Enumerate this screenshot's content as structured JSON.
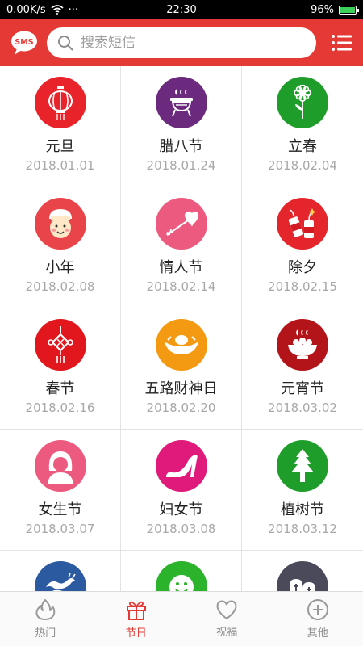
{
  "status_bar": {
    "speed": "0.00K/s",
    "dots": "···",
    "time": "22:30",
    "battery": "96%"
  },
  "header": {
    "badge_text": "SMS",
    "search_placeholder": "搜索短信"
  },
  "colors": {
    "accent": "#e53935"
  },
  "holidays": [
    {
      "name": "元旦",
      "date": "2018.01.01",
      "icon": "lantern-icon",
      "color": "#e8242a"
    },
    {
      "name": "腊八节",
      "date": "2018.01.24",
      "icon": "congee-pot-icon",
      "color": "#6b2a7e"
    },
    {
      "name": "立春",
      "date": "2018.02.04",
      "icon": "flower-icon",
      "color": "#1f9d2a"
    },
    {
      "name": "小年",
      "date": "2018.02.08",
      "icon": "kitchen-god-icon",
      "color": "#e8444a"
    },
    {
      "name": "情人节",
      "date": "2018.02.14",
      "icon": "heart-arrow-icon",
      "color": "#ec5a7f"
    },
    {
      "name": "除夕",
      "date": "2018.02.15",
      "icon": "firecracker-icon",
      "color": "#e4252b"
    },
    {
      "name": "春节",
      "date": "2018.02.16",
      "icon": "chinese-knot-icon",
      "color": "#e2171d"
    },
    {
      "name": "五路财神日",
      "date": "2018.02.20",
      "icon": "gold-ingot-icon",
      "color": "#f39a12"
    },
    {
      "name": "元宵节",
      "date": "2018.03.02",
      "icon": "tangyuan-bowl-icon",
      "color": "#b3141a"
    },
    {
      "name": "女生节",
      "date": "2018.03.07",
      "icon": "girl-icon",
      "color": "#ec5a7f"
    },
    {
      "name": "妇女节",
      "date": "2018.03.08",
      "icon": "high-heel-icon",
      "color": "#e01a7a"
    },
    {
      "name": "植树节",
      "date": "2018.03.12",
      "icon": "tree-icon",
      "color": "#1f9d2a"
    },
    {
      "name": "",
      "date": "",
      "icon": "dragon-icon",
      "color": "#2c5aa0"
    },
    {
      "name": "",
      "date": "",
      "icon": "smiley-icon",
      "color": "#2bb32b"
    },
    {
      "name": "",
      "date": "",
      "icon": "tombstone-icon",
      "color": "#4a4a5a"
    }
  ],
  "bottom_nav": [
    {
      "label": "热门",
      "icon": "flame-icon",
      "active": false
    },
    {
      "label": "节日",
      "icon": "gift-icon",
      "active": true
    },
    {
      "label": "祝福",
      "icon": "heart-icon",
      "active": false
    },
    {
      "label": "其他",
      "icon": "plus-circle-icon",
      "active": false
    }
  ]
}
